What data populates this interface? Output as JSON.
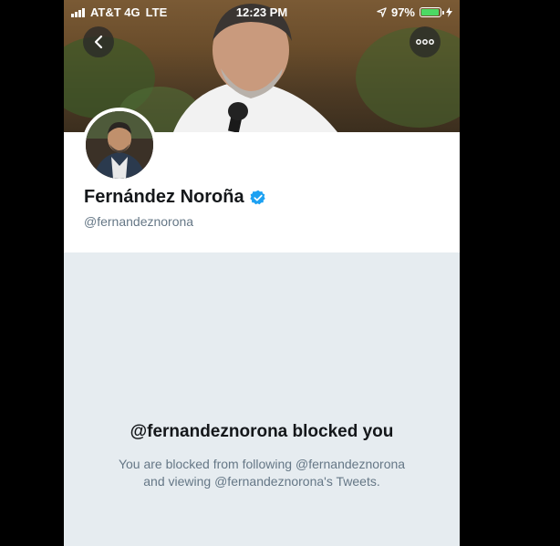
{
  "status_bar": {
    "carrier": "AT&T 4G",
    "network": "LTE",
    "time": "12:23 PM",
    "battery_percent": "97%",
    "battery_level": 0.97,
    "icons": [
      "signal-icon",
      "location-arrow-icon",
      "battery-icon",
      "charging-bolt-icon"
    ]
  },
  "nav": {
    "back_icon": "chevron-left-icon",
    "more_icon": "more-dots-icon"
  },
  "profile": {
    "name": "Fernández Noroña",
    "verified_icon": "verified-badge-icon",
    "handle": "@fernandeznorona"
  },
  "blocked": {
    "title": "@fernandeznorona blocked you",
    "line1": "You are blocked from following @fernandeznorona",
    "line2": "and viewing @fernandeznorona's Tweets."
  },
  "colors": {
    "verified": "#1da1f2",
    "background": "#e6ecf0",
    "secondary_text": "#657786",
    "battery": "#4cd964"
  }
}
